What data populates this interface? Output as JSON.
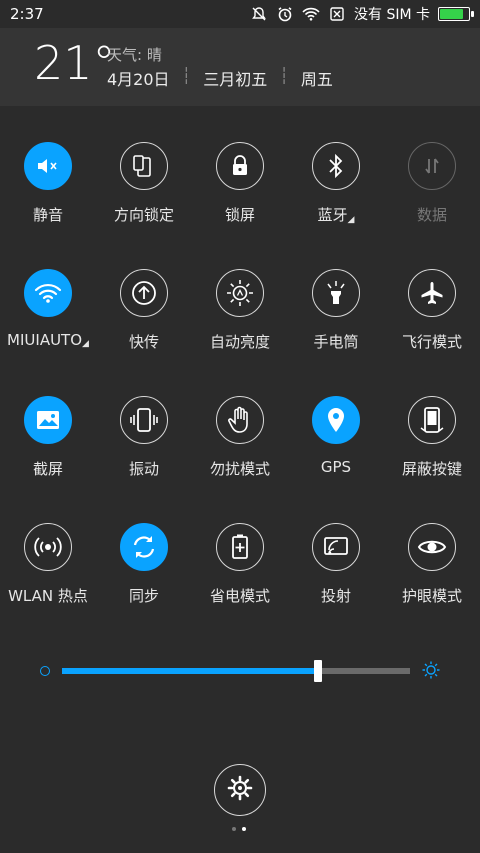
{
  "status": {
    "time": "2:37",
    "carrier": "没有 SIM 卡",
    "battery_level": 0.9,
    "battery_color": "#35d24a"
  },
  "header": {
    "temperature": "21°",
    "weather": "天气: 晴",
    "date": "4月20日",
    "lunar": "三月初五",
    "weekday": "周五"
  },
  "toggles": [
    {
      "label": "静音",
      "icon": "volume-mute-icon",
      "on": true
    },
    {
      "label": "方向锁定",
      "icon": "rotation-lock-icon",
      "on": false
    },
    {
      "label": "锁屏",
      "icon": "lock-icon",
      "on": false
    },
    {
      "label": "蓝牙",
      "icon": "bluetooth-icon",
      "on": false
    },
    {
      "label": "数据",
      "icon": "mobile-data-icon",
      "on": false,
      "disabled": true
    },
    {
      "label": "MIUIAUTO",
      "icon": "wifi-icon",
      "on": true
    },
    {
      "label": "快传",
      "icon": "quick-transfer-icon",
      "on": false
    },
    {
      "label": "自动亮度",
      "icon": "auto-brightness-icon",
      "on": false
    },
    {
      "label": "手电筒",
      "icon": "flashlight-icon",
      "on": false
    },
    {
      "label": "飞行模式",
      "icon": "airplane-icon",
      "on": false
    },
    {
      "label": "截屏",
      "icon": "screenshot-icon",
      "on": true
    },
    {
      "label": "振动",
      "icon": "vibrate-icon",
      "on": false
    },
    {
      "label": "勿扰模式",
      "icon": "do-not-disturb-icon",
      "on": false
    },
    {
      "label": "GPS",
      "icon": "location-icon",
      "on": true
    },
    {
      "label": "屏蔽按键",
      "icon": "block-keys-icon",
      "on": false
    },
    {
      "label": "WLAN 热点",
      "icon": "hotspot-icon",
      "on": false
    },
    {
      "label": "同步",
      "icon": "sync-icon",
      "on": true
    },
    {
      "label": "省电模式",
      "icon": "battery-saver-icon",
      "on": false
    },
    {
      "label": "投射",
      "icon": "cast-icon",
      "on": false
    },
    {
      "label": "护眼模式",
      "icon": "eye-icon",
      "on": false
    }
  ],
  "brightness": {
    "level": 0.735,
    "accent": "#0aa3ff"
  },
  "pager": {
    "count": 2,
    "active": 1
  }
}
